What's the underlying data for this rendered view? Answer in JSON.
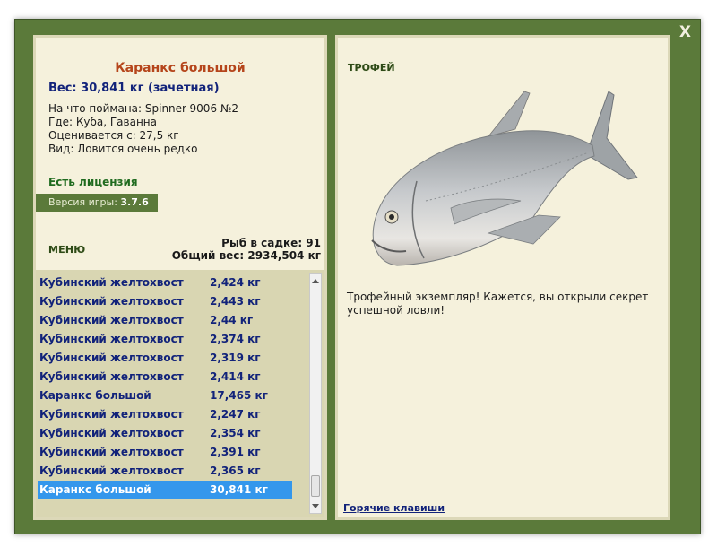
{
  "close_label": "X",
  "fish": {
    "name": "Каранкс большой",
    "weight": "Вес: 30,841 кг (зачетная)",
    "bait": "На что поймана: Spinner-9006 №2",
    "location": "Где: Куба, Гаванна",
    "valued_from": "Оценивается с: 27,5 кг",
    "rarity": "Вид: Ловится очень редко"
  },
  "license": "Есть лицензия",
  "version_label": "Версия игры: ",
  "version_value": "3.7.6",
  "menu_label": "МЕНЮ",
  "keepnet": {
    "count": "Рыб в садке: 91",
    "total": "Общий вес: 2934,504 кг"
  },
  "catch_list": [
    {
      "name": "Кубинский желтохвост",
      "weight": "2,424 кг"
    },
    {
      "name": "Кубинский желтохвост",
      "weight": "2,443 кг"
    },
    {
      "name": "Кубинский желтохвост",
      "weight": "2,44 кг"
    },
    {
      "name": "Кубинский желтохвост",
      "weight": "2,374 кг"
    },
    {
      "name": "Кубинский желтохвост",
      "weight": "2,319 кг"
    },
    {
      "name": "Кубинский желтохвост",
      "weight": "2,414 кг"
    },
    {
      "name": "Каранкс большой",
      "weight": "17,465 кг"
    },
    {
      "name": "Кубинский желтохвост",
      "weight": "2,247 кг"
    },
    {
      "name": "Кубинский желтохвост",
      "weight": "2,354 кг"
    },
    {
      "name": "Кубинский желтохвост",
      "weight": "2,391 кг"
    },
    {
      "name": "Кубинский желтохвост",
      "weight": "2,365 кг"
    },
    {
      "name": "Каранкс большой",
      "weight": "30,841 кг",
      "selected": true
    }
  ],
  "trophy_label": "ТРОФЕЙ",
  "trophy_text": "Трофейный экземпляр! Кажется, вы открыли секрет успешной ловли!",
  "hotkeys_label": "Горячие клавиши",
  "icons": {
    "close": "close-icon",
    "scroll_up": "arrow-up-icon",
    "scroll_down": "arrow-down-icon"
  },
  "colors": {
    "frame": "#5b7a3a",
    "panel": "#f5f1dc",
    "list_bg": "#d9d6b2",
    "selection": "#3497ec",
    "title": "#b5451b",
    "link": "#12237a"
  }
}
